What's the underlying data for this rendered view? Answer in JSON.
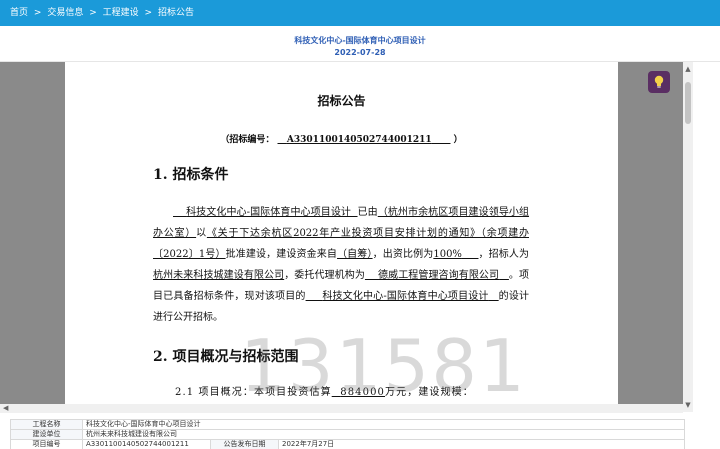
{
  "breadcrumb": {
    "items": [
      "首页",
      "交易信息",
      "工程建设",
      "招标公告"
    ],
    "separator": ">"
  },
  "header": {
    "title": "科技文化中心-国际体育中心项目设计",
    "date": "2022-07-28"
  },
  "document": {
    "title": "招标公告",
    "code_label": "（招标编号：",
    "code_value": "A3301100140502744001211",
    "code_close": "）",
    "section1_heading": "1.  招标条件",
    "section1": {
      "project_name": "科技文化中心-国际体育中心项目设计",
      "t1": "已由",
      "approver": "（杭州市余杭区项目建设领导小组办公室）",
      "t2": "以",
      "doc_name": "《关于下达余杭区2022年产业投资项目安排计划的通知》（余项建办〔2022〕1号）",
      "t3": "批准建设，建设资金来自",
      "fund_source": "（自筹）",
      "t4": "，出资比例为",
      "ratio": "100%",
      "t5": "，招标人为",
      "tenderer": "杭州未来科技城建设有限公司",
      "t6": "，委托代理机构为",
      "agency": "德威工程管理咨询有限公司",
      "t7": "。项目已具备招标条件，现对该项目的",
      "project_name2": "科技文化中心-国际体育中心项目设计",
      "t8": "的设计进行公开招标。"
    },
    "section2_heading": "2.  项目概况与招标范围",
    "section2_line": {
      "prefix": "2.1   项目概况：本项目投资估算",
      "amount": "884000",
      "suffix": "万元，建设规模："
    },
    "watermark": "131581"
  },
  "icons": {
    "tip_button": "lightbulb-icon",
    "scroll_up": "chevron-up-icon",
    "scroll_down": "chevron-down-icon",
    "scroll_left": "chevron-left-icon"
  },
  "info_table": {
    "rows": [
      {
        "label": "工程名称",
        "value": "科技文化中心-国际体育中心项目设计"
      },
      {
        "label": "建设单位",
        "value": "杭州未来科技城建设有限公司"
      }
    ],
    "row3": {
      "label": "项目编号",
      "value": "A3301100140502744001211",
      "label2": "公告发布日期",
      "value2": "2022年7月27日"
    }
  },
  "colors": {
    "topbar": "#1b9ad9",
    "title_blue": "#2f5fb5",
    "viewer_bg": "#8a8a8a",
    "tip_button": "#5a2e63"
  }
}
